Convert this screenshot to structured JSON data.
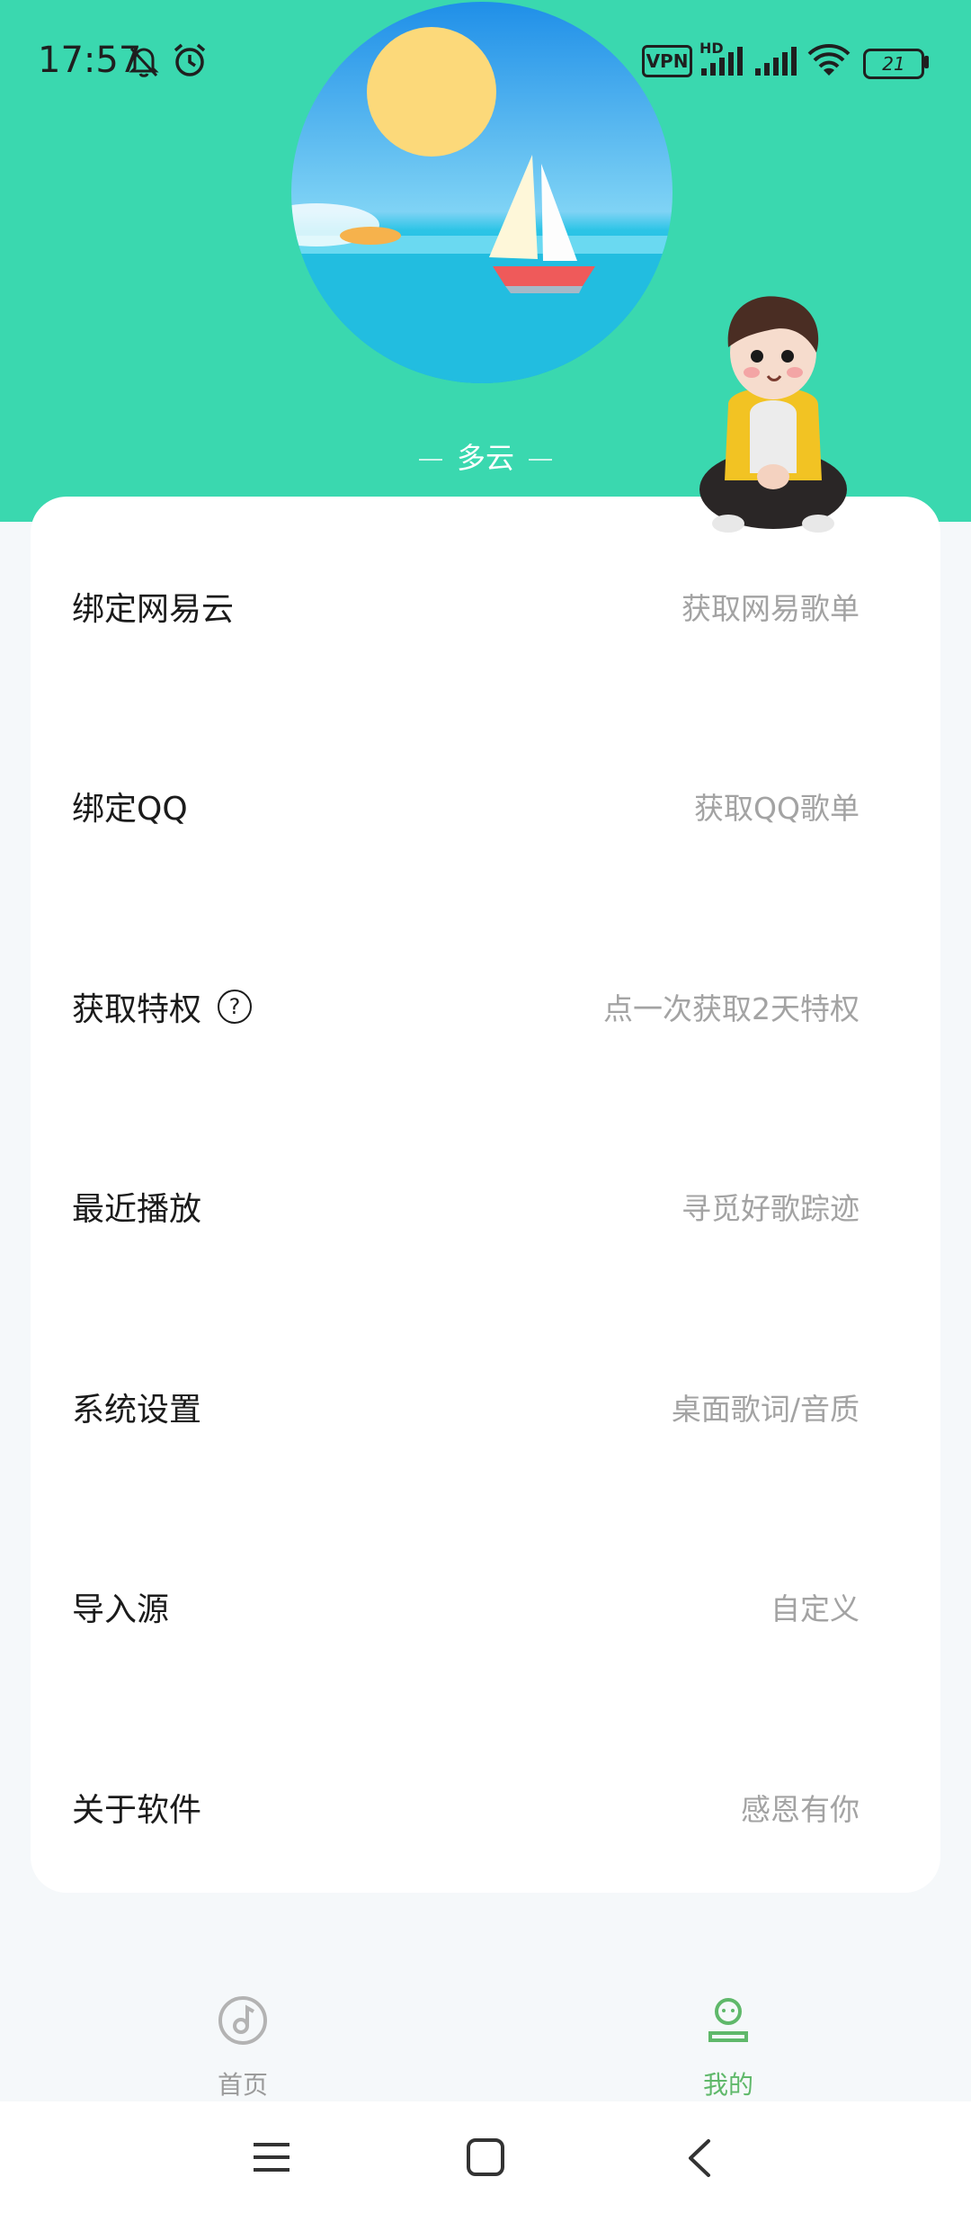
{
  "status_bar": {
    "time": "17:57",
    "vpn": "VPN",
    "hd": "HD",
    "battery": "21"
  },
  "header": {
    "weather_label": "多云"
  },
  "menu": [
    {
      "label": "绑定网易云",
      "hint": "获取网易歌单",
      "icon": null
    },
    {
      "label": "绑定QQ",
      "hint": "获取QQ歌单",
      "icon": null
    },
    {
      "label": "获取特权",
      "hint": "点一次获取2天特权",
      "icon": "question-circle-icon"
    },
    {
      "label": "最近播放",
      "hint": "寻觅好歌踪迹",
      "icon": null
    },
    {
      "label": "系统设置",
      "hint": "桌面歌词/音质",
      "icon": null
    },
    {
      "label": "导入源",
      "hint": "自定义",
      "icon": null
    },
    {
      "label": "关于软件",
      "hint": "感恩有你",
      "icon": null
    }
  ],
  "tabs": [
    {
      "label": "首页",
      "icon": "music-disc-icon",
      "active": false
    },
    {
      "label": "我的",
      "icon": "user-profile-icon",
      "active": true
    }
  ],
  "colors": {
    "header": "#3ad8af",
    "accent_active": "#5fb86a",
    "inactive": "#b3b3b3"
  },
  "icons": {
    "question": "?"
  }
}
